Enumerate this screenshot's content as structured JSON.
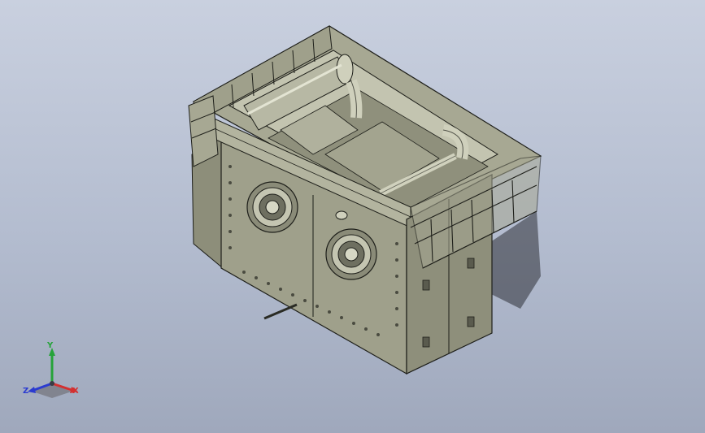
{
  "viewport": {
    "background_top": "#c9d0df",
    "background_bottom": "#9fa8bc",
    "model_color": "#9fa08b",
    "model_edge_color": "#1e1f1a"
  },
  "triad": {
    "x_label": "X",
    "y_label": "Y",
    "z_label": "Z",
    "x_color": "#d33030",
    "y_color": "#26a33a",
    "z_color": "#2b3bd0"
  }
}
